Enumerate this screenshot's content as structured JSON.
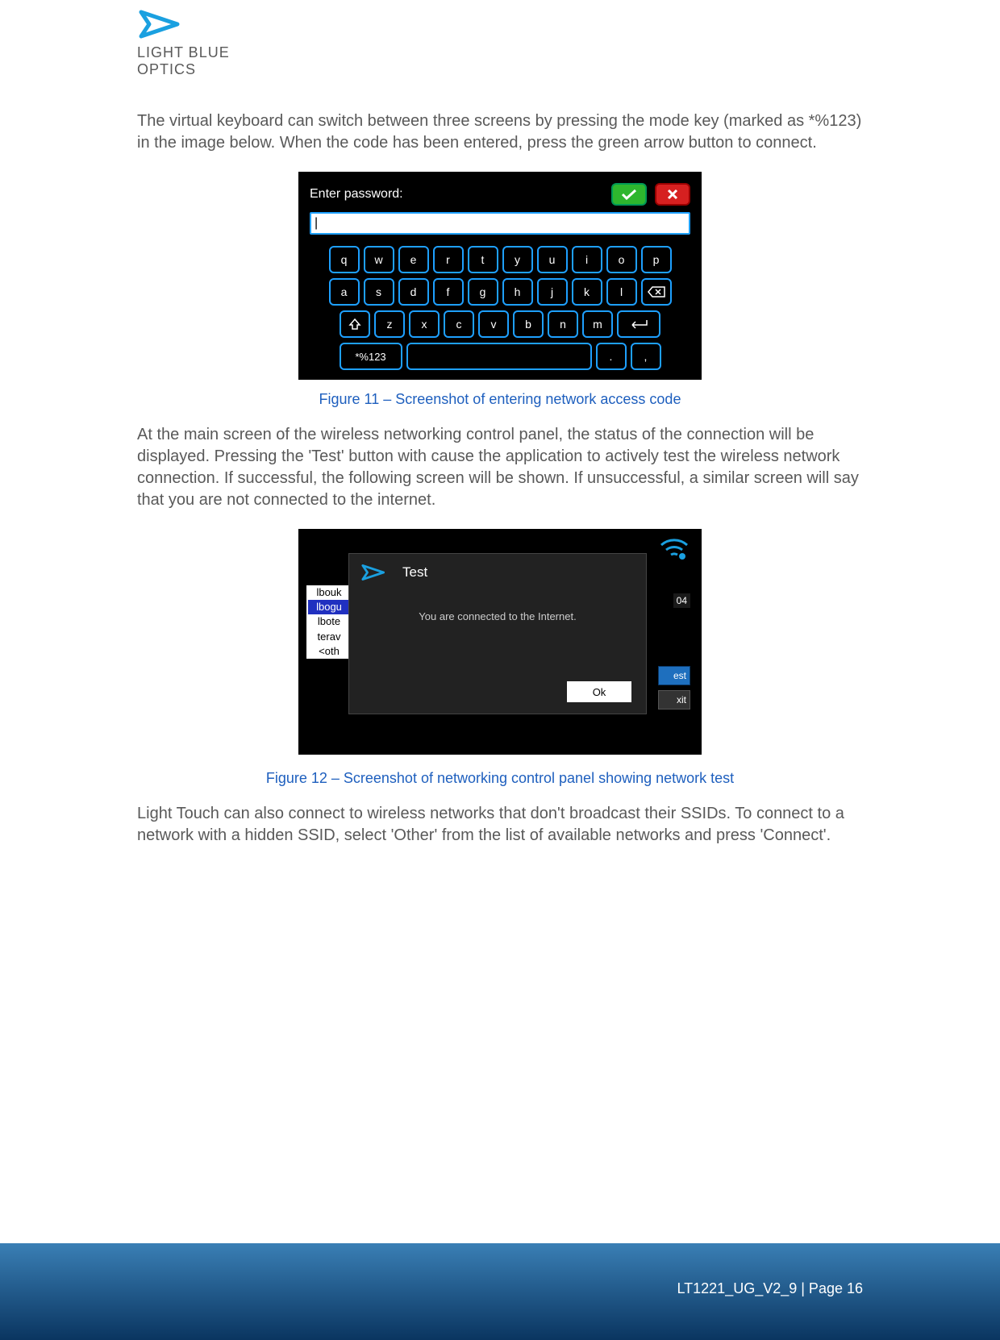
{
  "logo": {
    "line1": "LIGHT BLUE",
    "line2": "OPTICS"
  },
  "para1": "The virtual keyboard can switch between three screens by pressing the mode key (marked as *%123) in the image below. When the code has been entered, press the green arrow button to connect.",
  "keyboard": {
    "prompt": "Enter password:",
    "input_value": "|",
    "row1": [
      "q",
      "w",
      "e",
      "r",
      "t",
      "y",
      "u",
      "i",
      "o",
      "p"
    ],
    "row2": [
      "a",
      "s",
      "d",
      "f",
      "g",
      "h",
      "j",
      "k",
      "l"
    ],
    "row3": [
      "z",
      "x",
      "c",
      "v",
      "b",
      "n",
      "m"
    ],
    "mode_key": "*%123",
    "punct1": ".",
    "punct2": ","
  },
  "caption1": "Figure 11 – Screenshot of entering network access code",
  "para2": "At the main screen of the wireless networking control panel, the status of the connection will be displayed. Pressing the 'Test' button with cause the application to actively test the wireless network connection. If successful, the following screen will be shown. If unsuccessful, a similar screen will say that you are not connected to the internet.",
  "nettest": {
    "list": [
      "lbouk",
      "lbogu",
      "lbote",
      "terav",
      "<oth"
    ],
    "selected_index": 1,
    "badge": "04",
    "btn_est": "est",
    "btn_xit": "xit",
    "dialog_title": "Test",
    "dialog_msg": "You are connected to the Internet.",
    "ok_label": "Ok"
  },
  "caption2": "Figure 12 – Screenshot of networking control panel showing network test",
  "para3": "Light Touch can also connect to wireless networks that don't broadcast their SSIDs. To connect to a network with a hidden SSID, select 'Other' from the list of available networks and press 'Connect'.",
  "footer": "LT1221_UG_V2_9 | Page 16"
}
